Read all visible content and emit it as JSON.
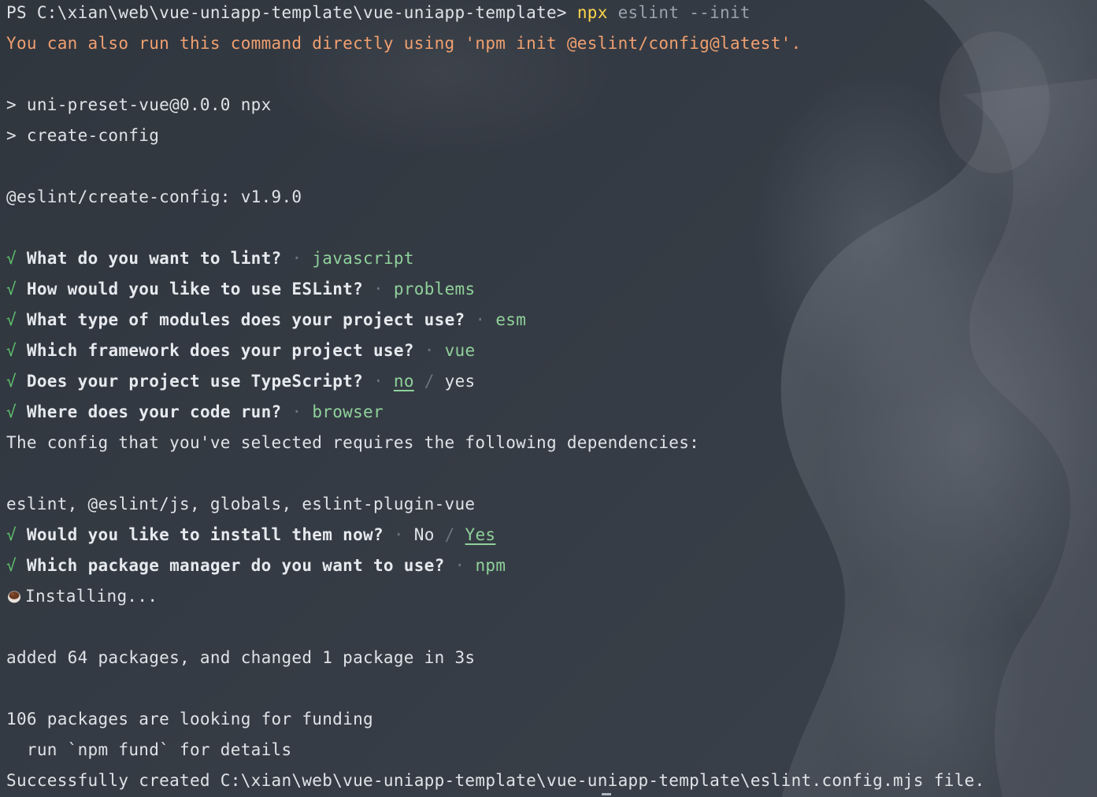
{
  "terminal": {
    "prompt": "PS C:\\xian\\web\\vue-uniapp-template\\vue-uniapp-template> ",
    "command_name": "npx",
    "command_args": " eslint --init",
    "hint": "You can also run this command directly using 'npm init @eslint/config@latest'.",
    "script_line_1": "> uni-preset-vue@0.0.0 npx",
    "script_line_2": "> create-config",
    "version_line": "@eslint/create-config: v1.9.0",
    "check_symbol": "√",
    "separator": "·",
    "slash": "/",
    "questions": [
      {
        "question": "What do you want to lint?",
        "answer": "javascript"
      },
      {
        "question": "How would you like to use ESLint?",
        "answer": "problems"
      },
      {
        "question": "What type of modules does your project use?",
        "answer": "esm"
      },
      {
        "question": "Which framework does your project use?",
        "answer": "vue"
      },
      {
        "question": "Does your project use TypeScript?",
        "answer_selected": "no",
        "answer_other": "yes"
      },
      {
        "question": "Where does your code run?",
        "answer": "browser"
      }
    ],
    "deps_intro": "The config that you've selected requires the following dependencies:",
    "deps_list": "eslint, @eslint/js, globals, eslint-plugin-vue",
    "install_question": "Would you like to install them now?",
    "install_other": "No",
    "install_selected": "Yes",
    "pm_question": "Which package manager do you want to use?",
    "pm_answer": "npm",
    "installing_icon": "coffee-cup-icon",
    "installing": "Installing...",
    "added": "added 64 packages, and changed 1 package in 3s",
    "funding": "106 packages are looking for funding",
    "funding_hint": "  run `npm fund` for details",
    "success": "Successfully created C:\\xian\\web\\vue-uniapp-template\\vue-uniapp-template\\eslint.config.mjs file."
  },
  "colors": {
    "background": "#2f353d",
    "text": "#dfe3e8",
    "command": "#ffd54a",
    "hint": "#f0a070",
    "answer": "#8fd19b",
    "check": "#5fc46e"
  }
}
